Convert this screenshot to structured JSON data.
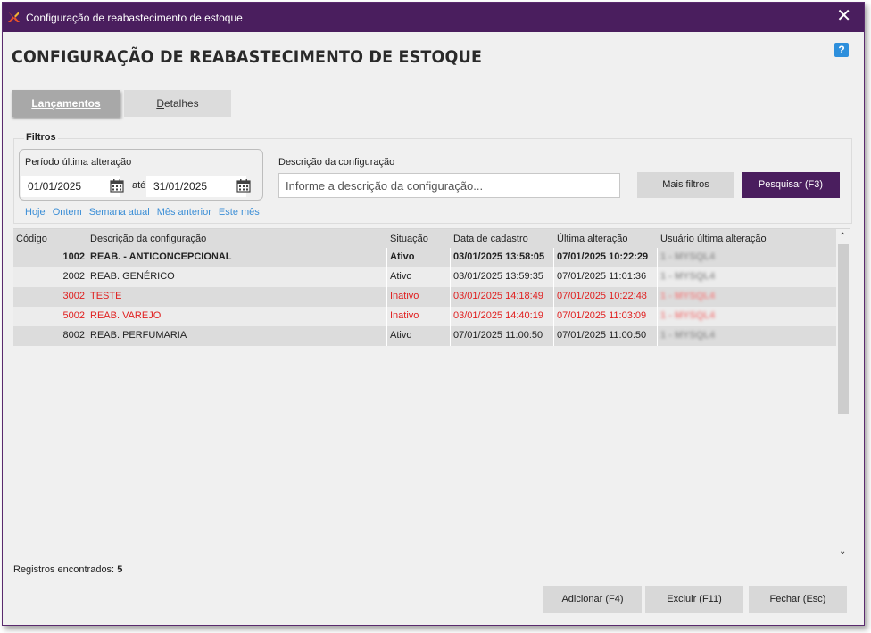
{
  "window": {
    "title": "Configuração de reabastecimento de estoque",
    "close_glyph": "✕"
  },
  "page": {
    "title": "CONFIGURAÇÃO DE REABASTECIMENTO DE ESTOQUE",
    "help_glyph": "?"
  },
  "tabs": [
    {
      "label": "Lançamentos"
    },
    {
      "label_underlined": "D",
      "label_rest": "etalhes"
    }
  ],
  "filters": {
    "label": "Filtros",
    "period_label": "Período última alteração",
    "date_from": "01/01/2025",
    "date_to": "31/01/2025",
    "between_label": "até",
    "quick_links": [
      "Hoje",
      "Ontem",
      "Semana atual",
      "Mês anterior",
      "Este mês"
    ],
    "description_label": "Descrição da configuração",
    "description_placeholder": "Informe a descrição da configuração...",
    "more_filters_label": "Mais filtros",
    "search_label": "Pesquisar (F3)"
  },
  "grid": {
    "columns": [
      "Código",
      "Descrição da configuração",
      "Situação",
      "Data de cadastro",
      "Última alteração",
      "Usuário última alteração"
    ],
    "rows": [
      {
        "code": "1002",
        "description": "REAB. - ANTICONCEPCIONAL",
        "status": "Ativo",
        "created": "03/01/2025 13:58:05",
        "updated": "07/01/2025 10:22:29",
        "user": "1 - MYSQL4"
      },
      {
        "code": "2002",
        "description": "REAB. GENÉRICO",
        "status": "Ativo",
        "created": "03/01/2025 13:59:35",
        "updated": "07/01/2025 11:01:36",
        "user": "1 - MYSQL4"
      },
      {
        "code": "3002",
        "description": "TESTE",
        "status": "Inativo",
        "created": "03/01/2025 14:18:49",
        "updated": "07/01/2025 10:22:48",
        "user": "1 - MYSQL4"
      },
      {
        "code": "5002",
        "description": "REAB. VAREJO",
        "status": "Inativo",
        "created": "03/01/2025 14:40:19",
        "updated": "07/01/2025 11:03:09",
        "user": "1 - MYSQL4"
      },
      {
        "code": "8002",
        "description": "REAB. PERFUMARIA",
        "status": "Ativo",
        "created": "07/01/2025 11:00:50",
        "updated": "07/01/2025 11:00:50",
        "user": "1 - MYSQL4"
      }
    ],
    "scroll_up_glyph": "⌃",
    "scroll_down_glyph": "⌄"
  },
  "footer": {
    "records_label": "Registros encontrados:",
    "records_count": "5",
    "add_label": "Adicionar (F4)",
    "delete_label": "Excluir (F11)",
    "close_label": "Fechar (Esc)"
  },
  "colors": {
    "titlebar": "#4a1e5e",
    "primary_button": "#4a1e5e",
    "inactive_text": "#e02020",
    "link": "#3b8ed6",
    "help": "#2d8fdc"
  },
  "icons": {
    "app": "app-logo-icon",
    "calendar": "calendar-icon",
    "help": "help-icon",
    "close": "close-icon"
  }
}
